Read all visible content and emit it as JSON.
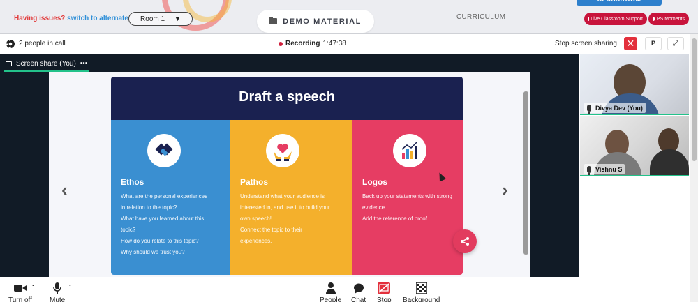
{
  "topbar": {
    "issues_prefix": "Having issues?",
    "issues_link": "switch to alternate room",
    "room_select": "Room 1",
    "demo_tab": "DEMO MATERIAL",
    "curriculum": "CURRICULUM",
    "classroom_badge": "CLASSROOM",
    "live_support": "Live Classroom Support",
    "ps_moments": "PS Moments"
  },
  "meeting": {
    "people_count": "2 people in call",
    "recording_label": "Recording",
    "recording_time": "1:47:38",
    "stop_sharing": "Stop screen sharing",
    "p_button": "P",
    "share_tab": "Screen share (You)",
    "share_tab_more": "•••"
  },
  "slide": {
    "title": "Draft a speech",
    "columns": [
      {
        "heading": "Ethos",
        "lines": [
          "What are the personal experiences",
          "in relation to the topic?",
          "What have you learned about this",
          "topic?",
          "How do you relate to this topic?",
          "Why should we trust you?"
        ]
      },
      {
        "heading": "Pathos",
        "lines": [
          "Understand what your audience is",
          "interested in, and use it to build your",
          "own speech!",
          "Connect the topic to their",
          "experiences."
        ]
      },
      {
        "heading": "Logos",
        "lines": [
          "Back up your statements with strong",
          "evidence.",
          "Add the reference of proof."
        ]
      }
    ]
  },
  "participants": [
    {
      "name": "Divya Dev (You)"
    },
    {
      "name": "Vishnu S"
    }
  ],
  "toolbar": {
    "turn_off": "Turn off",
    "mute": "Mute",
    "people": "People",
    "chat": "Chat",
    "stop": "Stop",
    "background": "Background"
  },
  "colors": {
    "accent_green": "#23c28a",
    "record_red": "#d01f3c",
    "slide_navy": "#1a2150",
    "ethos_blue": "#3a8fd1",
    "pathos_yellow": "#f4b02c",
    "logos_pink": "#e63d63",
    "support_crimson": "#c8143c"
  }
}
